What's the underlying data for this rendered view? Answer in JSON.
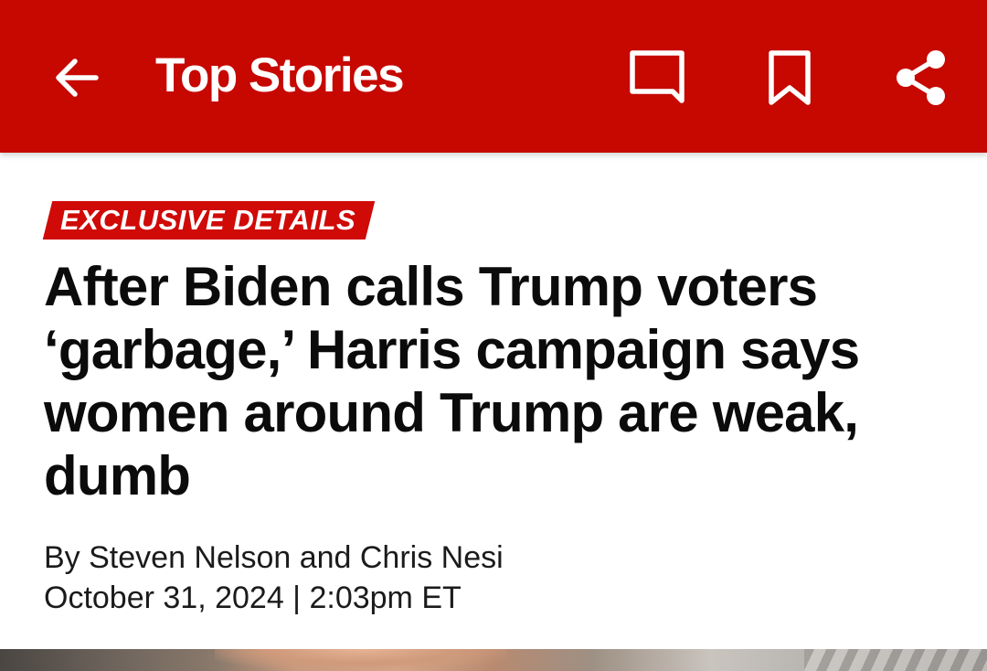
{
  "app_bar": {
    "title": "Top Stories",
    "background_color": "#c60800",
    "icons": {
      "back": "arrow-back-icon",
      "comments": "comment-icon",
      "bookmark": "bookmark-icon",
      "share": "share-icon"
    }
  },
  "article": {
    "tag": "EXCLUSIVE DETAILS",
    "tag_color": "#cf0a07",
    "headline": "After Biden calls Trump voters ‘garbage,’ Harris campaign says women around Trump are weak, dumb",
    "byline": "By Steven Nelson and Chris Nesi",
    "dateline": "October 31, 2024 | 2:03pm ET"
  }
}
